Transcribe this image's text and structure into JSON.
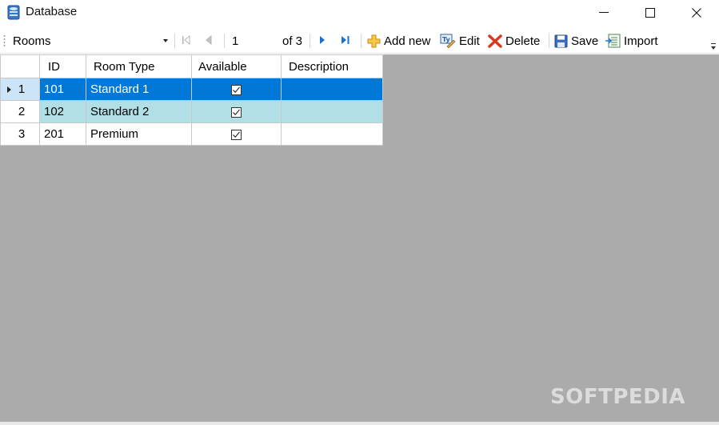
{
  "window": {
    "title": "Database",
    "icon": "database-icon",
    "controls": [
      "minimize-icon",
      "maximize-icon",
      "close-icon"
    ]
  },
  "toolbar": {
    "table_selector": "Rooms",
    "position": "1",
    "of_label": "of 3",
    "nav_icons": [
      "move-first-icon",
      "move-previous-icon",
      "move-next-icon",
      "move-last-icon"
    ],
    "add_new_label": "Add new",
    "edit_label": "Edit",
    "delete_label": "Delete",
    "save_label": "Save",
    "import_label": "Import"
  },
  "grid": {
    "columns": [
      "ID",
      "Room Type",
      "Available",
      "Description"
    ],
    "rows": [
      {
        "row_number": "1",
        "id": "101",
        "room_type": "Standard 1",
        "available": true,
        "description": "",
        "state": "selected"
      },
      {
        "row_number": "2",
        "id": "102",
        "room_type": "Standard 2",
        "available": true,
        "description": "",
        "state": "alternate"
      },
      {
        "row_number": "3",
        "id": "201",
        "room_type": "Premium",
        "available": true,
        "description": "",
        "state": "normal"
      }
    ]
  },
  "watermark": "SOFTPEDIA",
  "colors": {
    "selected_row": "#0078d7",
    "alternate_row": "#b0e0e6",
    "workspace": "#ababab"
  }
}
